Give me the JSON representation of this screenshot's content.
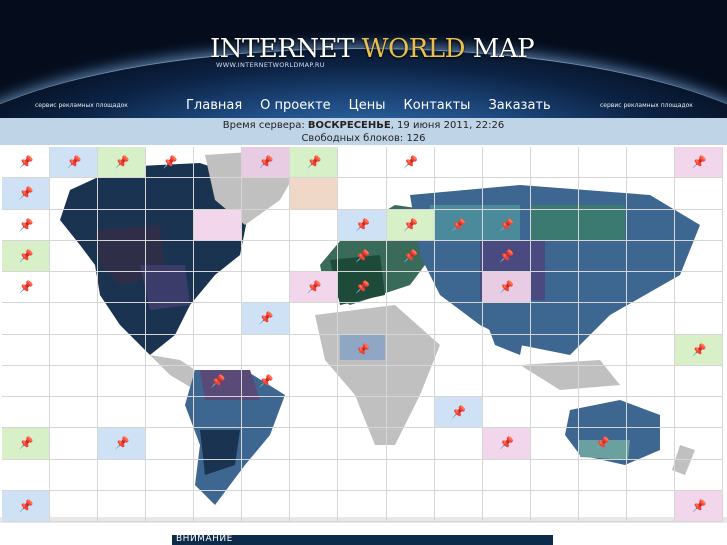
{
  "logo": {
    "part1": "INTERNET ",
    "part2": "WORLD",
    "part3": " MAP",
    "url": "WWW.INTERNETWORLDMAP.RU"
  },
  "nav": {
    "left_text": "сервис рекламных площадок",
    "right_text": "сервис рекламных площадок",
    "links": [
      "Главная",
      "О проекте",
      "Цены",
      "Контакты",
      "Заказать"
    ]
  },
  "info": {
    "server_time_label": "Время сервера: ",
    "server_time_day": "ВОСКРЕСЕНЬЕ",
    "server_time_rest": ", 19 июня 2011, 22:26",
    "free_blocks_label": "Свободных блоков: ",
    "free_blocks_value": "126"
  },
  "notice": {
    "label": "ВНИМАНИЕ"
  },
  "colors": {
    "land_gray": "#c0c0c0",
    "land_blue": "#3d6690",
    "land_dark": "#1a3350",
    "accent": "#bfd4e6"
  },
  "icons": {
    "pin": "pushpin-icon"
  }
}
